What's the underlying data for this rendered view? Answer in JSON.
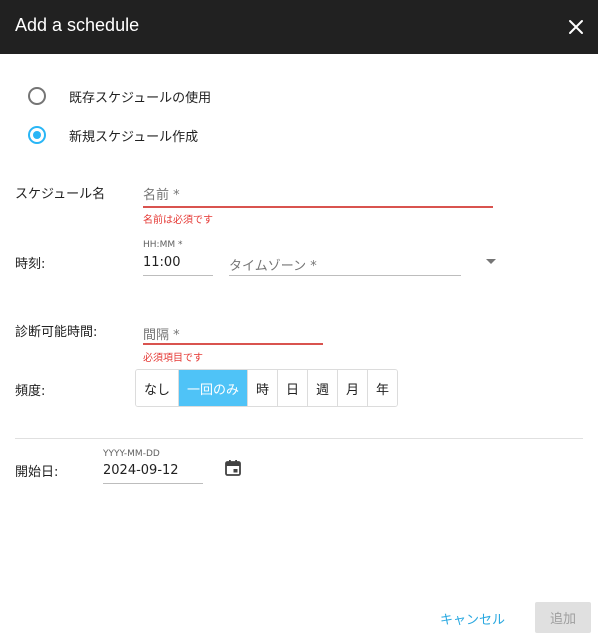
{
  "dialog": {
    "title": "Add a schedule",
    "close_icon": "close-icon"
  },
  "mode": {
    "existing_label": "既存スケジュールの使用",
    "new_label": "新規スケジュール作成",
    "selected": "new"
  },
  "schedule_name": {
    "label": "スケジュール名",
    "placeholder": "名前 *",
    "error": "名前は必須です"
  },
  "time": {
    "label": "時刻:",
    "field_label": "HH:MM *",
    "value": "11:00",
    "timezone_placeholder": "タイムゾーン *",
    "dropdown_icon": "caret-down-icon"
  },
  "interval": {
    "label": "診断可能時間:",
    "placeholder": "間隔 *",
    "error": "必須項目です"
  },
  "frequency": {
    "label": "頻度:",
    "options": [
      "なし",
      "一回のみ",
      "時",
      "日",
      "週",
      "月",
      "年"
    ],
    "selected": "一回のみ"
  },
  "start_date": {
    "label": "開始日:",
    "field_label": "YYYY-MM-DD",
    "value": "2024-09-12",
    "icon": "calendar-icon"
  },
  "actions": {
    "cancel_label": "キャンセル",
    "add_label": "追加"
  },
  "colors": {
    "accent": "#29b6f6",
    "active_toggle": "#4fc3f7",
    "error": "#e53935",
    "titlebar": "#212121"
  }
}
